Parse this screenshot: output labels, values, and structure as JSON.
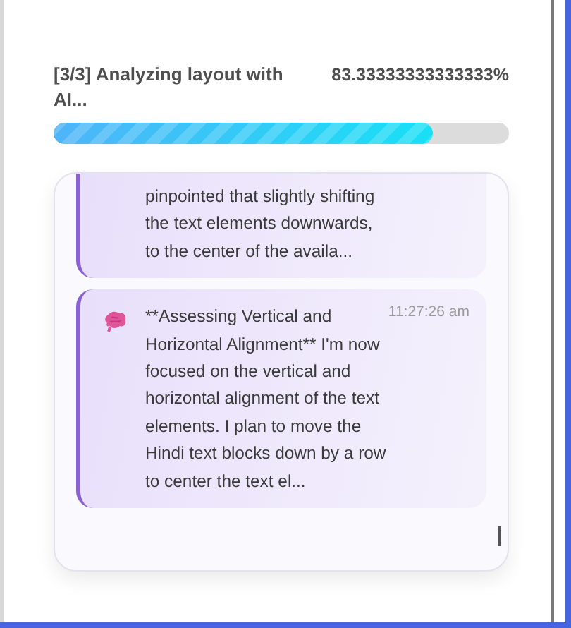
{
  "progress": {
    "label": "[3/3] Analyzing layout with AI...",
    "percent": "83.33333333333333%",
    "level": 0.8333
  },
  "messages": [
    {
      "text": "pinpointed that slightly shifting the text elements downwards, to the center of the availa..."
    },
    {
      "text": "**Assessing Vertical and Horizontal Alignment** I'm now focused on the vertical and horizontal alignment of the text elements. I plan to move the Hindi text blocks down by a row to center the text el...",
      "time": "11:27:26 am",
      "icon": true
    }
  ]
}
